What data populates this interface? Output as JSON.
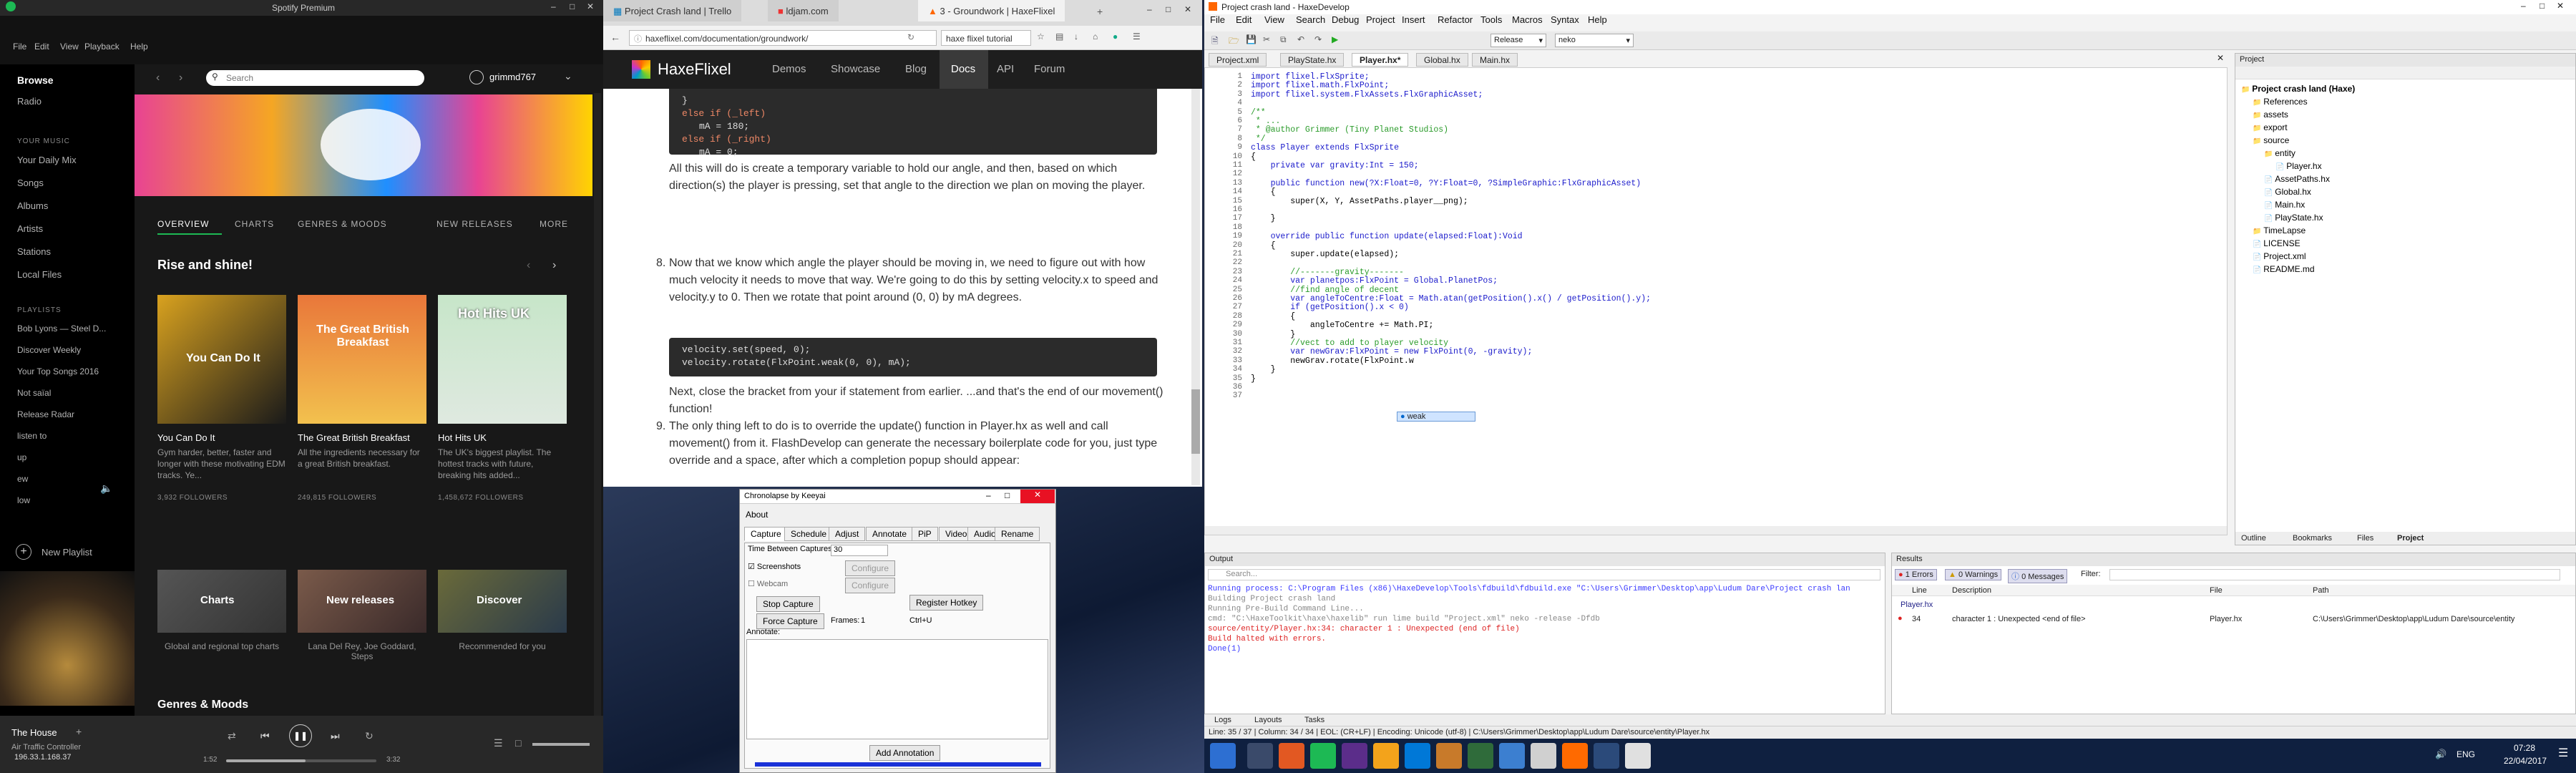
{
  "spotify": {
    "title": "Spotify Premium",
    "menu": [
      "File",
      "Edit",
      "View",
      "Playback",
      "Help"
    ],
    "search_placeholder": "Search",
    "user": "grimmd767",
    "nav": [
      "Browse",
      "Radio"
    ],
    "your_music_heading": "YOUR MUSIC",
    "your_music": [
      "Your Daily Mix",
      "Songs",
      "Albums",
      "Artists",
      "Stations",
      "Local Files"
    ],
    "playlists_heading": "PLAYLISTS",
    "playlists": [
      "Bob Lyons — Steel D...",
      "Discover Weekly",
      "Your Top Songs 2016",
      "Not saïal",
      "Release Radar",
      "listen to",
      "up",
      "ew",
      "low"
    ],
    "new_playlist": "New Playlist",
    "tabs": [
      "OVERVIEW",
      "CHARTS",
      "GENRES & MOODS",
      "NEW RELEASES",
      "MORE"
    ],
    "section_title": "Rise and shine!",
    "cards": [
      {
        "title": "You Can Do It",
        "art": "You Can Do It",
        "desc": "Gym harder, better, faster and longer with these motivating EDM tracks. Ye...",
        "followers": "3,932 FOLLOWERS"
      },
      {
        "title": "The Great British Breakfast",
        "art": "The Great British Breakfast",
        "desc": "All the ingredients necessary for a great British breakfast.",
        "followers": "249,815 FOLLOWERS"
      },
      {
        "title": "Hot Hits UK",
        "art": "Hot Hits UK",
        "desc": "The UK's biggest playlist. The hottest tracks with future, breaking hits added...",
        "followers": "1,458,672 FOLLOWERS"
      }
    ],
    "genre_cards": [
      {
        "title": "Charts",
        "desc": "Global and regional top charts"
      },
      {
        "title": "New releases",
        "desc": "Lana Del Rey, Joe Goddard, Steps"
      },
      {
        "title": "Discover",
        "desc": "Recommended for you"
      }
    ],
    "genres_heading": "Genres & Moods",
    "now_playing": {
      "track": "The House",
      "artist": "Air Traffic Controller",
      "elapsed": "1:52",
      "duration": "3:32"
    },
    "coords_overlay": "196.33.1.168.37"
  },
  "chrome": {
    "tabs": [
      "Project Crash land | Trello",
      "ldjam.com",
      "3 - Groundwork | HaxeFlixel"
    ],
    "url": "haxeflixel.com/documentation/groundwork/",
    "search_box": "haxe flixel tutorial",
    "site_name": "HaxeFlixel",
    "site_nav": [
      "Demos",
      "Showcase",
      "Blog",
      "Docs",
      "API",
      "Forum"
    ],
    "code_top": [
      "}",
      "else if (_left)",
      "    mA = 180;",
      "else if (_right)",
      "    mA = 0;"
    ],
    "para1": "All this will do is create a temporary variable to hold our angle, and then, based on which direction(s) the player is pressing, set that angle to the direction we plan on moving the player.",
    "item8_num": "8.",
    "item8": "Now that we know which angle the player should be moving in, we need to figure out with how much velocity it needs to move that way. We're going to do this by setting velocity.x to speed and velocity.y to 0. Then we rotate that point around (0, 0) by mA degrees.",
    "code_mid": [
      "velocity.set(speed, 0);",
      "velocity.rotate(FlxPoint.weak(0, 0), mA);"
    ],
    "para2": "Next, close the bracket from your if statement from earlier. ...and that's the end of our movement() function!",
    "item9_num": "9.",
    "item9": "The only thing left to do is to override the update() function in Player.hx as well and call movement() from it. FlashDevelop can generate the necessary boilerplate code for you, just type override and a space, after which a completion popup should appear:"
  },
  "chronolapse": {
    "title": "Chronolapse by Keeyai",
    "menu": "About",
    "tabs": [
      "Capture",
      "Schedule",
      "Adjust",
      "Annotate",
      "PiP",
      "Video",
      "Audio",
      "Rename"
    ],
    "time_between": "Time Between Captures:",
    "time_value": "30",
    "screenshots": "Screenshots",
    "webcam": "Webcam",
    "configure": "Configure",
    "register_hotkey": "Register Hotkey",
    "stop_capture": "Stop Capture",
    "force_capture": "Force Capture",
    "frames_label": "Frames:",
    "frames_value": "1",
    "hotkey_value": "Ctrl+U",
    "annotate_label": "Annotate:",
    "add_annotation": "Add Annotation"
  },
  "haxedevelop": {
    "title": "Project crash land - HaxeDevelop",
    "menu": [
      "File",
      "Edit",
      "View",
      "Search",
      "Debug",
      "Project",
      "Insert",
      "Refactor",
      "Tools",
      "Macros",
      "Syntax",
      "Help"
    ],
    "config": "Release",
    "target": "neko",
    "editor_tabs": [
      "Project.xml",
      "PlayState.hx",
      "Player.hx*",
      "Global.hx",
      "Main.hx"
    ],
    "code": [
      "import flixel.FlxSprite;",
      "import flixel.math.FlxPoint;",
      "import flixel.system.FlxAssets.FlxGraphicAsset;",
      "",
      "/**",
      " * ...",
      " * @author Grimmer (Tiny Planet Studios)",
      " */",
      "class Player extends FlxSprite",
      "{",
      "    private var gravity:Int = 150;",
      "",
      "    public function new(?X:Float=0, ?Y:Float=0, ?SimpleGraphic:FlxGraphicAsset)",
      "    {",
      "        super(X, Y, AssetPaths.player__png);",
      "",
      "    }",
      "",
      "    override public function update(elapsed:Float):Void",
      "    {",
      "        super.update(elapsed);",
      "",
      "        //-------gravity-------",
      "        var planetpos:FlxPoint = Global.PlanetPos;",
      "        //find angle of decent",
      "        var angleToCentre:Float = Math.atan(getPosition().x() / getPosition().y);",
      "        if (getPosition().x < 0)",
      "        {",
      "            angleToCentre += Math.PI;",
      "        }",
      "        //vect to add to player velocity",
      "        var newGrav:FlxPoint = new FlxPoint(0, -gravity);",
      "        newGrav.rotate(FlxPoint.w",
      "    }",
      "}",
      "",
      ""
    ],
    "autocomplete": "weak",
    "project_panel_title": "Project",
    "project_tree": [
      "Project crash land (Haxe)",
      "References",
      "assets",
      "export",
      "source",
      "entity",
      "Player.hx",
      "AssetPaths.hx",
      "Global.hx",
      "Main.hx",
      "PlayState.hx",
      "TimeLapse",
      "LICENSE",
      "Project.xml",
      "README.md"
    ],
    "side_tabs": [
      "Outline",
      "Bookmarks",
      "Files",
      "Project"
    ],
    "output_title": "Output",
    "output_search": "Search...",
    "output_lines": [
      "Running process: C:\\Program Files (x86)\\HaxeDevelop\\Tools\\fdbuild\\fdbuild.exe \"C:\\Users\\Grimmer\\Desktop\\app\\Ludum Dare\\Project crash lan",
      "Building Project crash land",
      "Running Pre-Build Command Line...",
      "cmd: \"C:\\HaxeToolkit\\haxe\\haxelib\" run lime build \"Project.xml\" neko -release -Dfdb",
      "source/entity/Player.hx:34: character 1 : Unexpected (end of file)",
      "Build halted with errors.",
      "Done(1)"
    ],
    "results_title": "Results",
    "results_filters": [
      "1 Errors",
      "0 Warnings",
      "0 Messages"
    ],
    "filter_label": "Filter:",
    "results_headers": [
      "Line",
      "Description",
      "File",
      "Path"
    ],
    "results_group": "Player.hx",
    "results_row": {
      "line": "34",
      "desc": "character 1 : Unexpected <end of file>",
      "file": "Player.hx",
      "path": "C:\\Users\\Grimmer\\Desktop\\app\\Ludum Dare\\source\\entity"
    },
    "bottom_tabs": [
      "Logs",
      "Layouts",
      "Tasks"
    ],
    "status": "Line: 35 / 37  |  Column: 34 / 34  |  EOL: (CR+LF)  |  Encoding: Unicode (utf-8)  |  C:\\Users\\Grimmer\\Desktop\\app\\Ludum Dare\\source\\entity\\Player.hx"
  },
  "taskbar": {
    "time": "07:28",
    "date": "22/04/2017",
    "lang": "ENG"
  }
}
